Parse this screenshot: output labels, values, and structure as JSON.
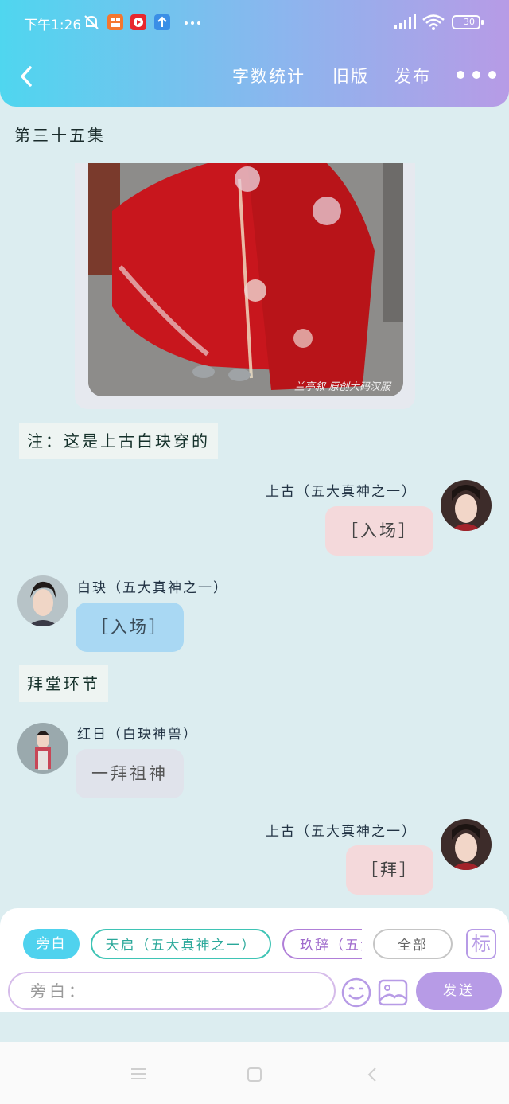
{
  "status": {
    "time": "下午1:26",
    "battery": "30",
    "icons": [
      "mute-bell-icon",
      "app-icon-orange",
      "app-icon-red",
      "upload-icon",
      "more-dots-icon",
      "signal-icon",
      "wifi-icon",
      "battery-icon"
    ]
  },
  "nav": {
    "back_icon": "chevron-left-icon",
    "word_count": "字数统计",
    "old_version": "旧版",
    "publish": "发布",
    "more_icon": "three-dots-icon"
  },
  "episode": {
    "title": "第三十五集"
  },
  "photo": {
    "watermark": "兰亭叙 原创大码汉服"
  },
  "messages": {
    "note1": "注：这是上古白玦穿的",
    "m1_speaker": "上古（五大真神之一）",
    "m1_text": "［入场］",
    "m2_speaker": "白玦（五大真神之一）",
    "m2_text": "［入场］",
    "narr2": "拜堂环节",
    "m3_speaker": "红日（白玦神兽）",
    "m3_text": "一拜祖神",
    "m4_speaker": "上古（五大真神之一）",
    "m4_text": "［拜］"
  },
  "composer": {
    "chips": [
      "旁白",
      "天启（五大真神之一）",
      "玖辞（五大",
      "全部"
    ],
    "mark_label": "标",
    "input_placeholder": "旁白：",
    "send": "发送"
  },
  "colors": {
    "header_start": "#4fd6ef",
    "header_end": "#b79be6",
    "background": "#dcedf0",
    "bubble_pink": "#f4d9db",
    "bubble_blue": "#a9d8f3",
    "bubble_gray": "#e0e3eb"
  }
}
